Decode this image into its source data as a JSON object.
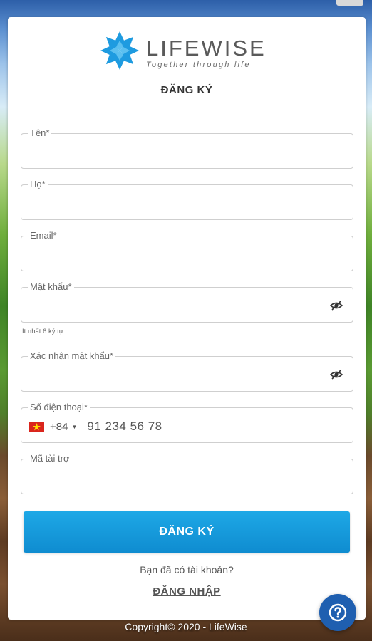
{
  "brand": {
    "name": "LIFEWISE",
    "tagline": "Together through life",
    "mark_color": "#1e9be0"
  },
  "form": {
    "title": "ĐĂNG KÝ",
    "fields": {
      "first_name": {
        "label": "Tên*",
        "value": ""
      },
      "last_name": {
        "label": "Họ*",
        "value": ""
      },
      "email": {
        "label": "Email*",
        "value": ""
      },
      "password": {
        "label": "Mật khẩu*",
        "value": "",
        "icon": "eye-slash-icon"
      },
      "password_hint": "Ít nhất 6 ký tự",
      "confirm_password": {
        "label": "Xác nhận mật khẩu*",
        "value": "",
        "icon": "eye-slash-icon"
      },
      "phone": {
        "label": "Số điện thoại*",
        "country": "Vietnam",
        "dial_code": "+84",
        "placeholder": "91 234 56 78"
      },
      "sponsor_code": {
        "label": "Mã tài trợ",
        "value": ""
      }
    },
    "submit_label": "ĐĂNG KÝ",
    "have_account_text": "Bạn đã có tài khoản?",
    "login_link": "ĐĂNG NHẬP"
  },
  "footer": {
    "copyright": "Copyright© 2020 - LifeWise"
  },
  "help_button": {
    "icon": "question-circle-icon"
  },
  "colors": {
    "primary_button": "#129bdc",
    "help_button": "#1f5fb0"
  }
}
